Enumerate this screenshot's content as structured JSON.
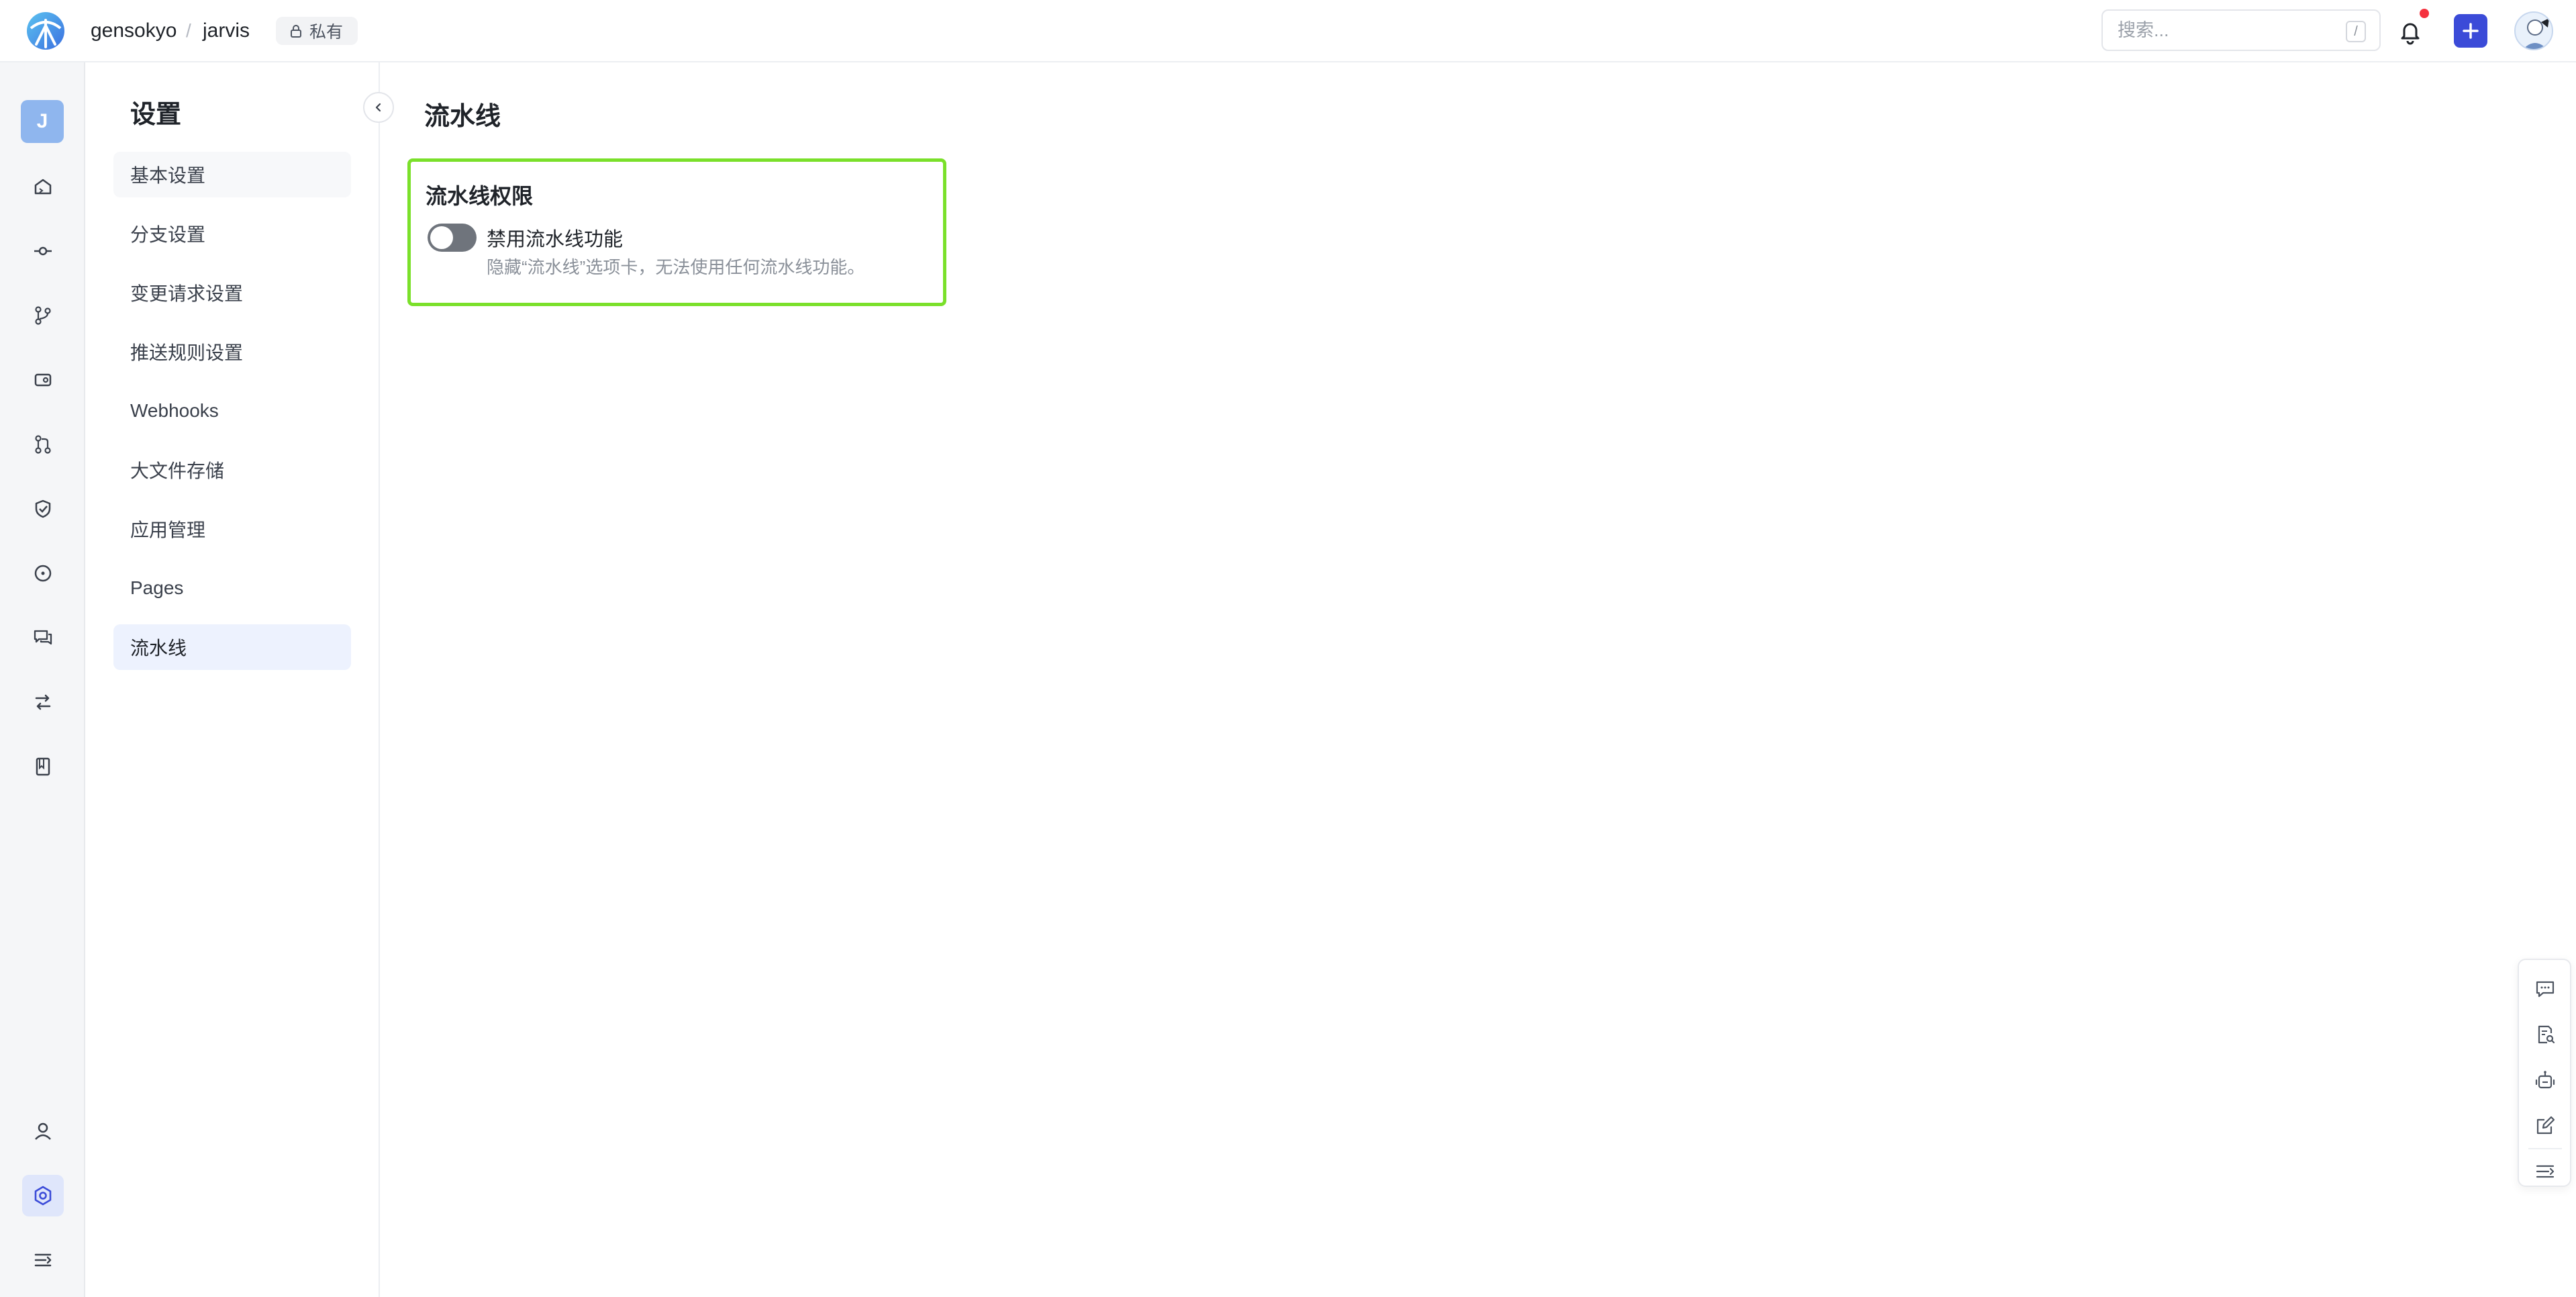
{
  "header": {
    "org": "gensokyo",
    "separator": "/",
    "repo": "jarvis",
    "visibility_badge": "私有",
    "search_placeholder": "搜索...",
    "search_shortcut": "/",
    "new_button_icon": "plus-icon",
    "notification_icon": "bell-icon",
    "has_unread_notifications": true
  },
  "rail": {
    "project_initial": "J",
    "items": [
      "home-icon",
      "commit-icon",
      "branch-icon",
      "package-icon",
      "pull-request-icon",
      "shield-icon",
      "issue-icon",
      "discussion-icon",
      "compare-icon",
      "wiki-icon"
    ],
    "bottom_items": [
      "user-icon",
      "settings-icon",
      "collapse-menu-icon"
    ],
    "active": "settings-icon"
  },
  "settings": {
    "title": "设置",
    "menu": [
      {
        "label": "基本设置"
      },
      {
        "label": "分支设置"
      },
      {
        "label": "变更请求设置"
      },
      {
        "label": "推送规则设置"
      },
      {
        "label": "Webhooks"
      },
      {
        "label": "大文件存储"
      },
      {
        "label": "应用管理"
      },
      {
        "label": "Pages"
      },
      {
        "label": "流水线"
      }
    ],
    "active_item": "流水线"
  },
  "main": {
    "title": "流水线",
    "card": {
      "title": "流水线权限",
      "toggle_on": false,
      "option_label": "禁用流水线功能",
      "option_description": "隐藏“流水线”选项卡，无法使用任何流水线功能。"
    }
  },
  "float_toolbar": [
    "comment-icon",
    "search-doc-icon",
    "robot-icon",
    "edit-icon",
    "collapse-icon"
  ],
  "colors": {
    "accent": "#3b4bd8",
    "highlight_border": "#7ae02a",
    "active_menu_bg": "#edf2fe",
    "toggle_off": "#6f747c",
    "notification_dot": "#f5313f"
  }
}
